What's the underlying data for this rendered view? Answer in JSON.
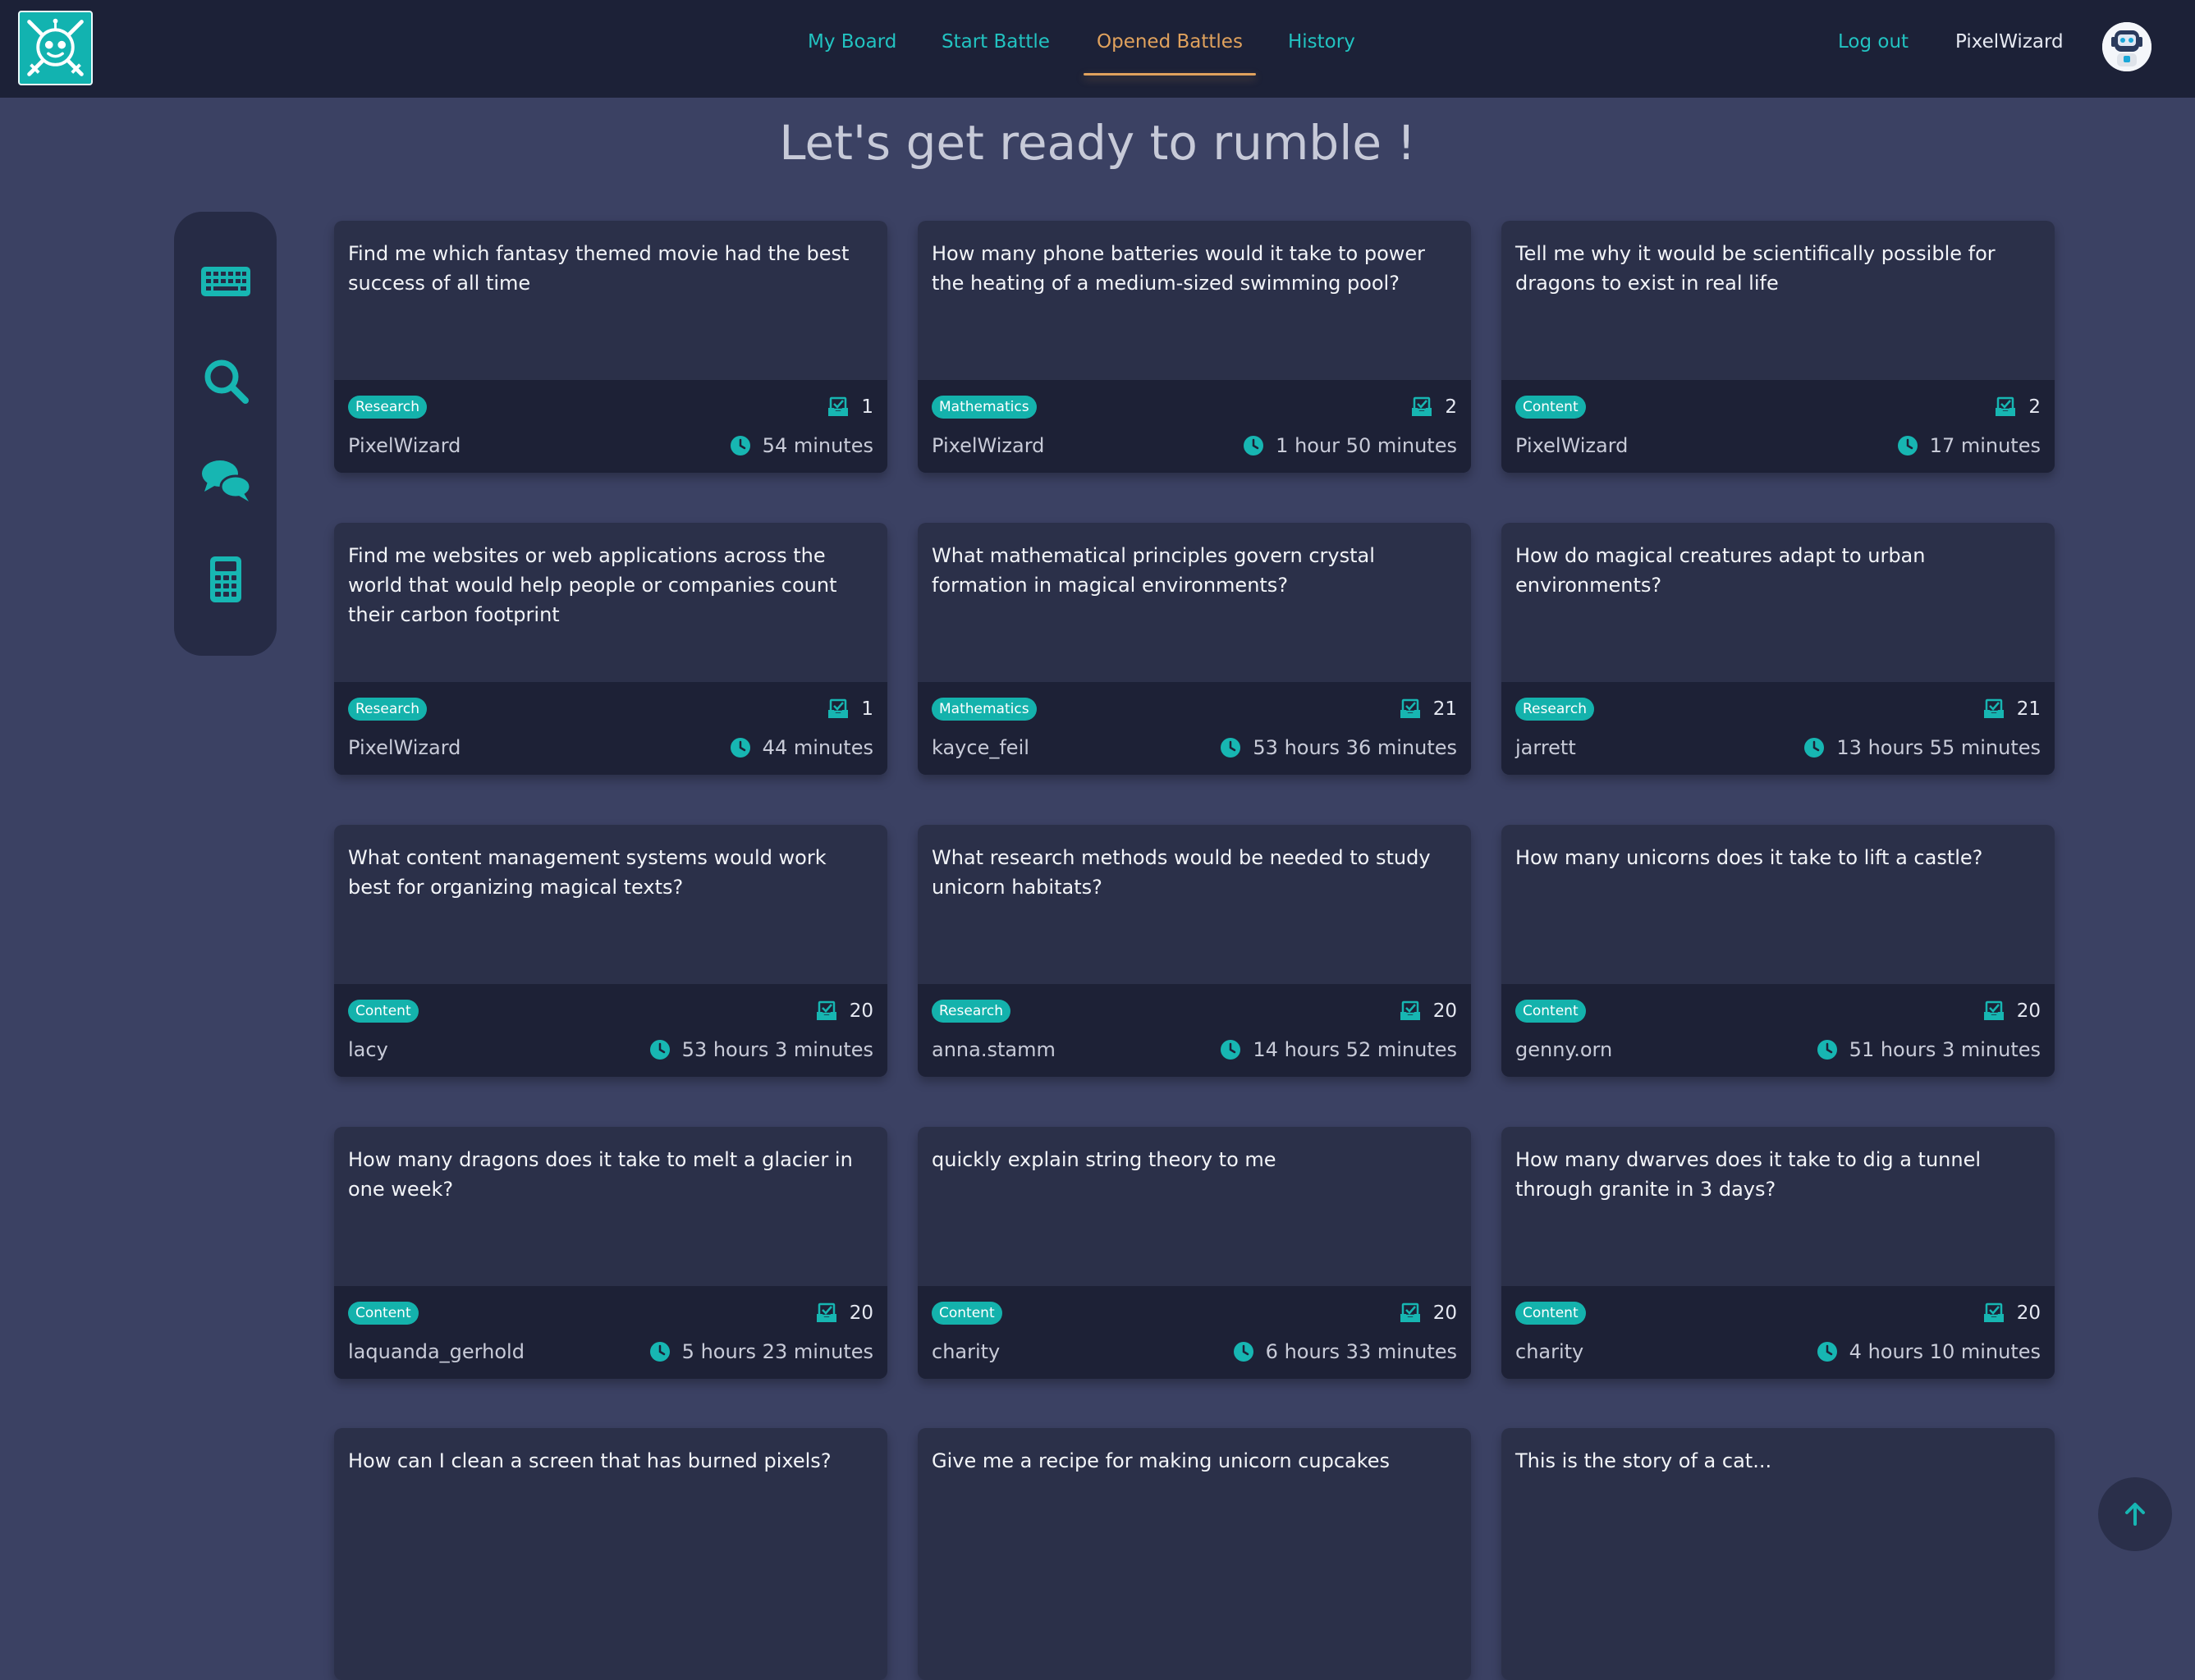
{
  "nav": {
    "items": [
      {
        "label": "My Board",
        "active": false
      },
      {
        "label": "Start Battle",
        "active": false
      },
      {
        "label": "Opened Battles",
        "active": true
      },
      {
        "label": "History",
        "active": false
      }
    ],
    "logout": "Log out",
    "username": "PixelWizard"
  },
  "page": {
    "title": "Let's get ready to rumble !"
  },
  "sidebar": {
    "items": [
      {
        "icon": "keyboard-icon"
      },
      {
        "icon": "search-icon"
      },
      {
        "icon": "chat-bubbles-icon"
      },
      {
        "icon": "calculator-icon"
      }
    ]
  },
  "colors": {
    "accent": "#14b2ac",
    "active_nav": "#e0a25d",
    "background": "#3b4163",
    "topbar": "#1c2137",
    "card": "#2b3049",
    "card_footer": "#1d2136"
  },
  "battles": [
    {
      "question": "Find me which fantasy themed movie had the best success of all time",
      "category": "Research",
      "count": "1",
      "author": "PixelWizard",
      "time": "54 minutes"
    },
    {
      "question": "How many phone batteries would it take to power the heating of a medium-sized swimming pool?",
      "category": "Mathematics",
      "count": "2",
      "author": "PixelWizard",
      "time": "1 hour 50 minutes"
    },
    {
      "question": "Tell me why it would be scientifically possible for dragons to exist in real life",
      "category": "Content",
      "count": "2",
      "author": "PixelWizard",
      "time": "17 minutes"
    },
    {
      "question": "Find me websites or web applications across the world that would help people or companies count their carbon footprint",
      "category": "Research",
      "count": "1",
      "author": "PixelWizard",
      "time": "44 minutes"
    },
    {
      "question": "What mathematical principles govern crystal formation in magical environments?",
      "category": "Mathematics",
      "count": "21",
      "author": "kayce_feil",
      "time": "53 hours 36 minutes"
    },
    {
      "question": "How do magical creatures adapt to urban environments?",
      "category": "Research",
      "count": "21",
      "author": "jarrett",
      "time": "13 hours 55 minutes"
    },
    {
      "question": "What content management systems would work best for organizing magical texts?",
      "category": "Content",
      "count": "20",
      "author": "lacy",
      "time": "53 hours 3 minutes"
    },
    {
      "question": "What research methods would be needed to study unicorn habitats?",
      "category": "Research",
      "count": "20",
      "author": "anna.stamm",
      "time": "14 hours 52 minutes"
    },
    {
      "question": "How many unicorns does it take to lift a castle?",
      "category": "Content",
      "count": "20",
      "author": "genny.orn",
      "time": "51 hours 3 minutes"
    },
    {
      "question": "How many dragons does it take to melt a glacier in one week?",
      "category": "Content",
      "count": "20",
      "author": "laquanda_gerhold",
      "time": "5 hours 23 minutes"
    },
    {
      "question": "quickly explain string theory to me",
      "category": "Content",
      "count": "20",
      "author": "charity",
      "time": "6 hours 33 minutes"
    },
    {
      "question": "How many dwarves does it take to dig a tunnel through granite in 3 days?",
      "category": "Content",
      "count": "20",
      "author": "charity",
      "time": "4 hours 10 minutes"
    },
    {
      "question": "How can I clean a screen that has burned pixels?"
    },
    {
      "question": "Give me a recipe for making unicorn cupcakes"
    },
    {
      "question": "This is the story of a cat..."
    }
  ]
}
